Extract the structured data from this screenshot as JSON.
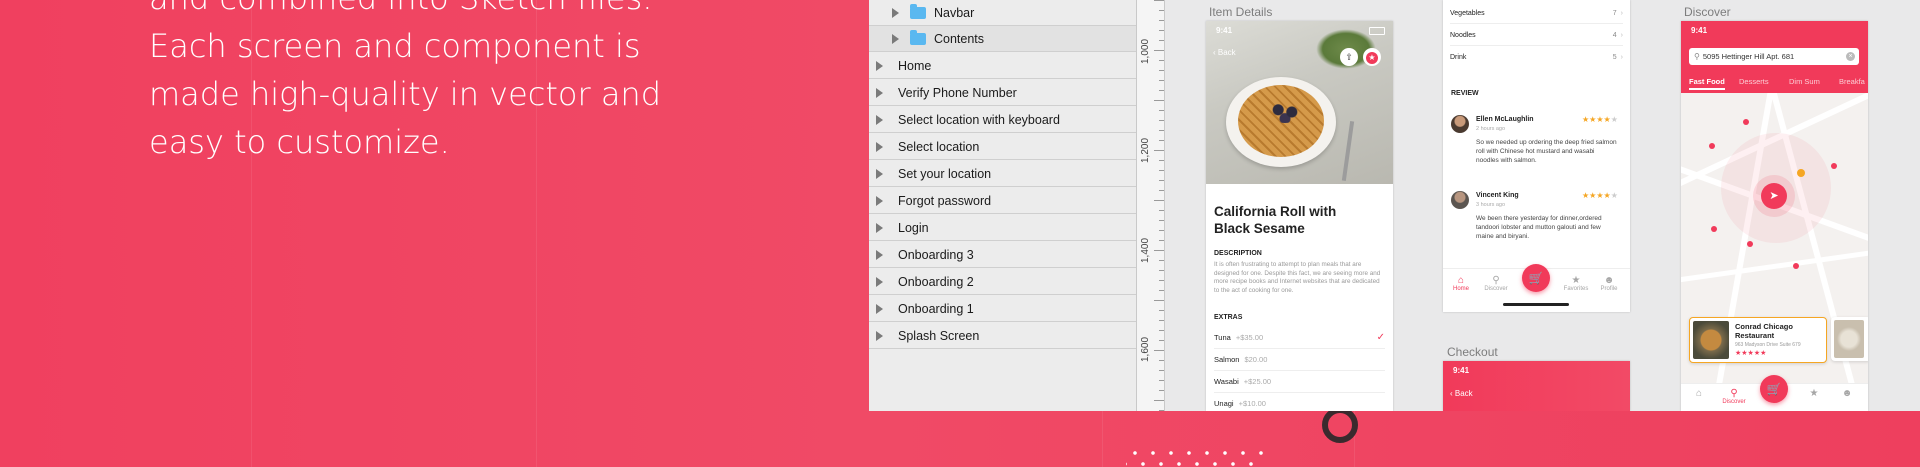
{
  "intro": {
    "lines": [
      "and combined into Sketch files.",
      "Each screen and component is",
      "made high-quality in vector and",
      "easy to customize."
    ]
  },
  "layers": [
    {
      "label": "Navbar",
      "sub": true,
      "folder": true
    },
    {
      "label": "Contents",
      "sub": true,
      "folder": true
    },
    {
      "label": "Home"
    },
    {
      "label": "Verify Phone Number"
    },
    {
      "label": "Select location with keyboard"
    },
    {
      "label": "Select location"
    },
    {
      "label": "Set your location"
    },
    {
      "label": "Forgot password"
    },
    {
      "label": "Login"
    },
    {
      "label": "Onboarding 3"
    },
    {
      "label": "Onboarding 2"
    },
    {
      "label": "Onboarding 1"
    },
    {
      "label": "Splash Screen"
    }
  ],
  "ruler": {
    "labels": [
      "1,000",
      "1,200",
      "1,400",
      "1,600"
    ]
  },
  "artboards": {
    "item_details": {
      "label": "Item Details",
      "time": "9:41",
      "back": "Back",
      "title_line1": "California Roll with",
      "title_line2": "Black Sesame",
      "description_heading": "DESCRIPTION",
      "description": "It is often frustrating to attempt to plan meals that are designed for one. Despite this fact, we are seeing more and more recipe books and Internet websites that are dedicated to the act of cooking for one.",
      "extras_heading": "EXTRAS",
      "extras": [
        {
          "name": "Tuna",
          "price": "+$35.00",
          "checked": true
        },
        {
          "name": "Salmon",
          "price": "$20.00"
        },
        {
          "name": "Wasabi",
          "price": "+$25.00"
        },
        {
          "name": "Unagi",
          "price": "+$10.00"
        }
      ]
    },
    "reviews": {
      "categories": [
        {
          "name": "Vegetables",
          "count": "7"
        },
        {
          "name": "Noodles",
          "count": "4"
        },
        {
          "name": "Drink",
          "count": "5"
        }
      ],
      "review_heading": "REVIEW",
      "reviews": [
        {
          "name": "Ellen McLaughlin",
          "time": "2 hours ago",
          "text": "So we needed up ordering the deep fried salmon roll with Chinese hot mustard and wasabi noodles with salmon."
        },
        {
          "name": "Vincent King",
          "time": "3 hours ago",
          "text": "We been there yesterday for dinner,ordered tandoori lobster and mutton galouti and few maine and biryani."
        }
      ],
      "tabs": [
        "Home",
        "Discover",
        "",
        "Favorites",
        "Profile"
      ]
    },
    "checkout": {
      "label": "Checkout",
      "time": "9:41",
      "back": "Back"
    },
    "discover": {
      "label": "Discover",
      "time": "9:41",
      "address": "5095 Hettinger Hill Apt. 681",
      "tabs": [
        "Fast Food",
        "Desserts",
        "Dim Sum",
        "Breakfa"
      ],
      "card_name_line1": "Conrad Chicago",
      "card_name_line2": "Restaurant",
      "card_address": "963 Madyson Drive Suite 679",
      "bottom_tabs": [
        "",
        "Discover",
        "",
        "",
        ""
      ]
    }
  },
  "colors": {
    "accent": "#f13a5a",
    "background": "#f0405f",
    "star": "#f5a623"
  }
}
